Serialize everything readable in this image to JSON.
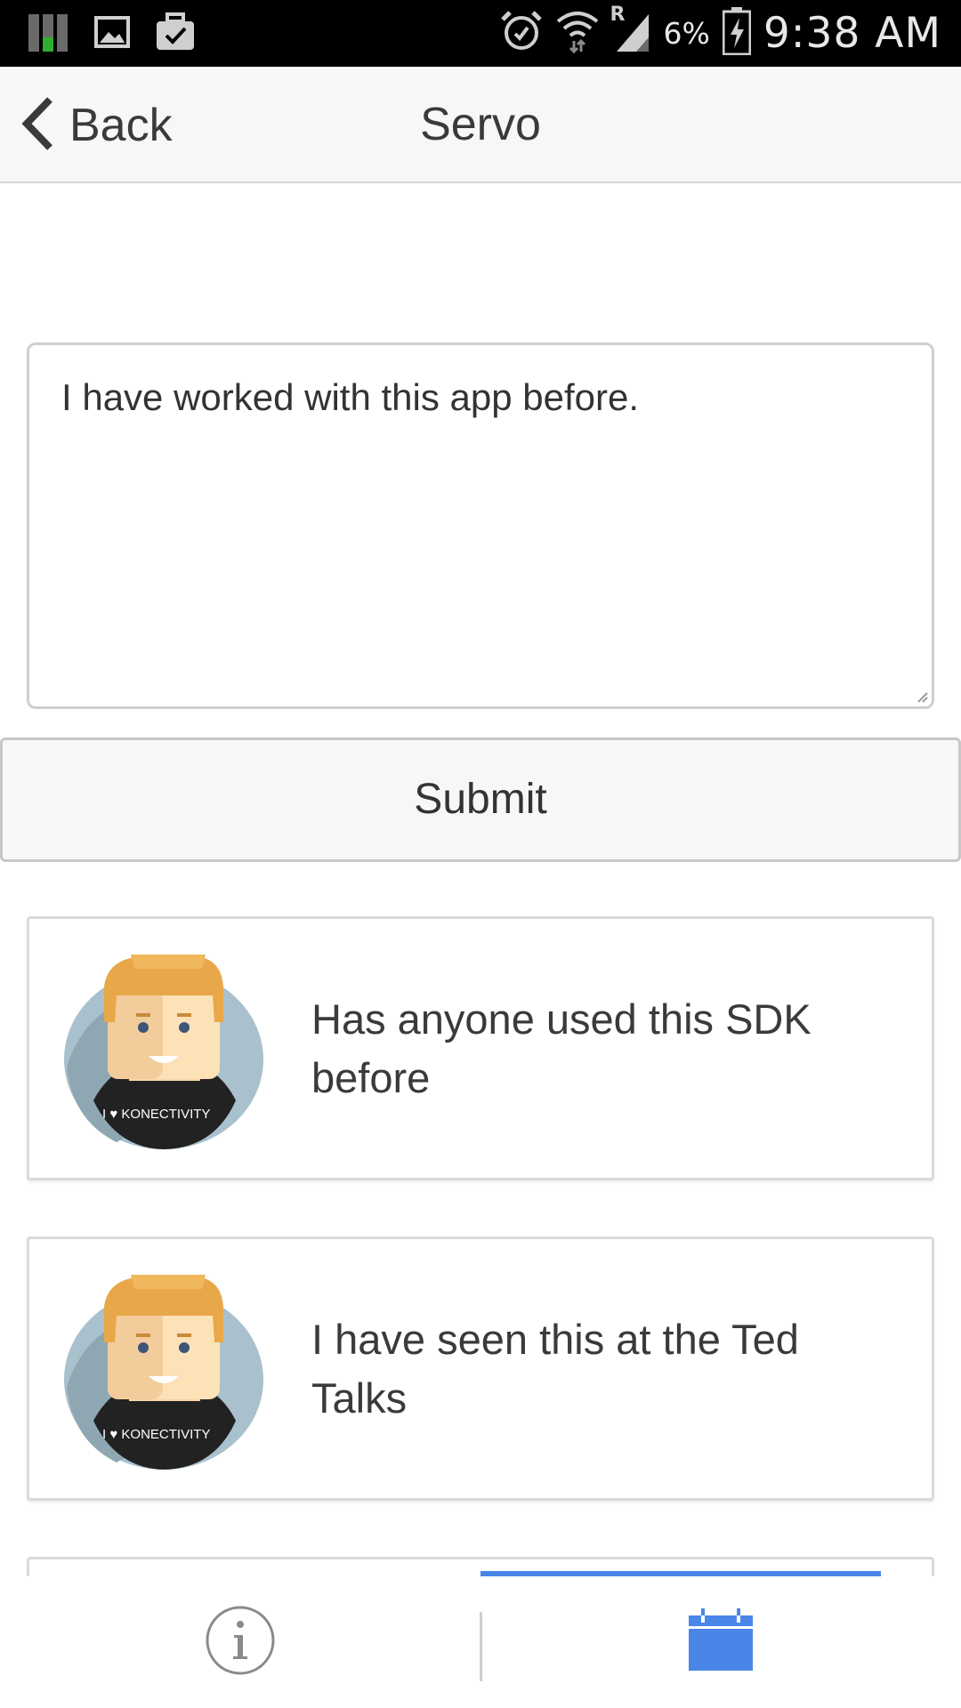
{
  "status_bar": {
    "battery_percent": "6%",
    "time": "9:38 AM",
    "network_roaming": "R",
    "icons": [
      "signal-bars-icon",
      "gallery-icon",
      "briefcase-check-icon",
      "alarm-icon",
      "wifi-icon",
      "cell-signal-icon",
      "battery-charging-icon"
    ]
  },
  "header": {
    "back_label": "Back",
    "title": "Servo"
  },
  "comment_box": {
    "value": "I have worked with this app before."
  },
  "submit": {
    "label": "Submit"
  },
  "posts": [
    {
      "text": "Has anyone used this SDK before",
      "avatar_caption": "I ♥ KONECTIVITY"
    },
    {
      "text": "I have seen this at the Ted Talks",
      "avatar_caption": "I ♥ KONECTIVITY"
    }
  ],
  "bottom_nav": {
    "items": [
      {
        "icon": "info-icon",
        "active": false
      },
      {
        "icon": "calendar-icon",
        "active": true
      }
    ],
    "active_color": "#4a86e8"
  }
}
